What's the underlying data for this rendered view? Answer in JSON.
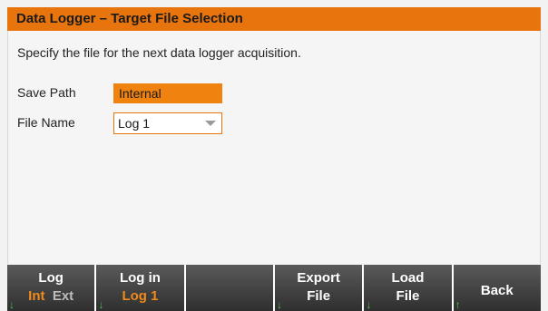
{
  "title": "Data Logger – Target File Selection",
  "instruction": "Specify the file for the next data logger acquisition.",
  "fields": {
    "save_path": {
      "label": "Save Path",
      "value": "Internal"
    },
    "file_name": {
      "label": "File Name",
      "value": "Log 1"
    }
  },
  "softkeys": {
    "log": {
      "line1": "Log",
      "opt_int": "Int",
      "opt_ext": "Ext"
    },
    "log_in": {
      "line1": "Log in",
      "line2": "Log 1"
    },
    "export_file": {
      "line1": "Export",
      "line2": "File"
    },
    "load_file": {
      "line1": "Load",
      "line2": "File"
    },
    "back": {
      "label": "Back"
    }
  },
  "icons": {
    "down_arrow": "↓",
    "up_arrow": "↑"
  },
  "colors": {
    "accent": "#e8740e",
    "softkey_bg": "#3c3c3c",
    "indicator": "#4fc24f"
  }
}
